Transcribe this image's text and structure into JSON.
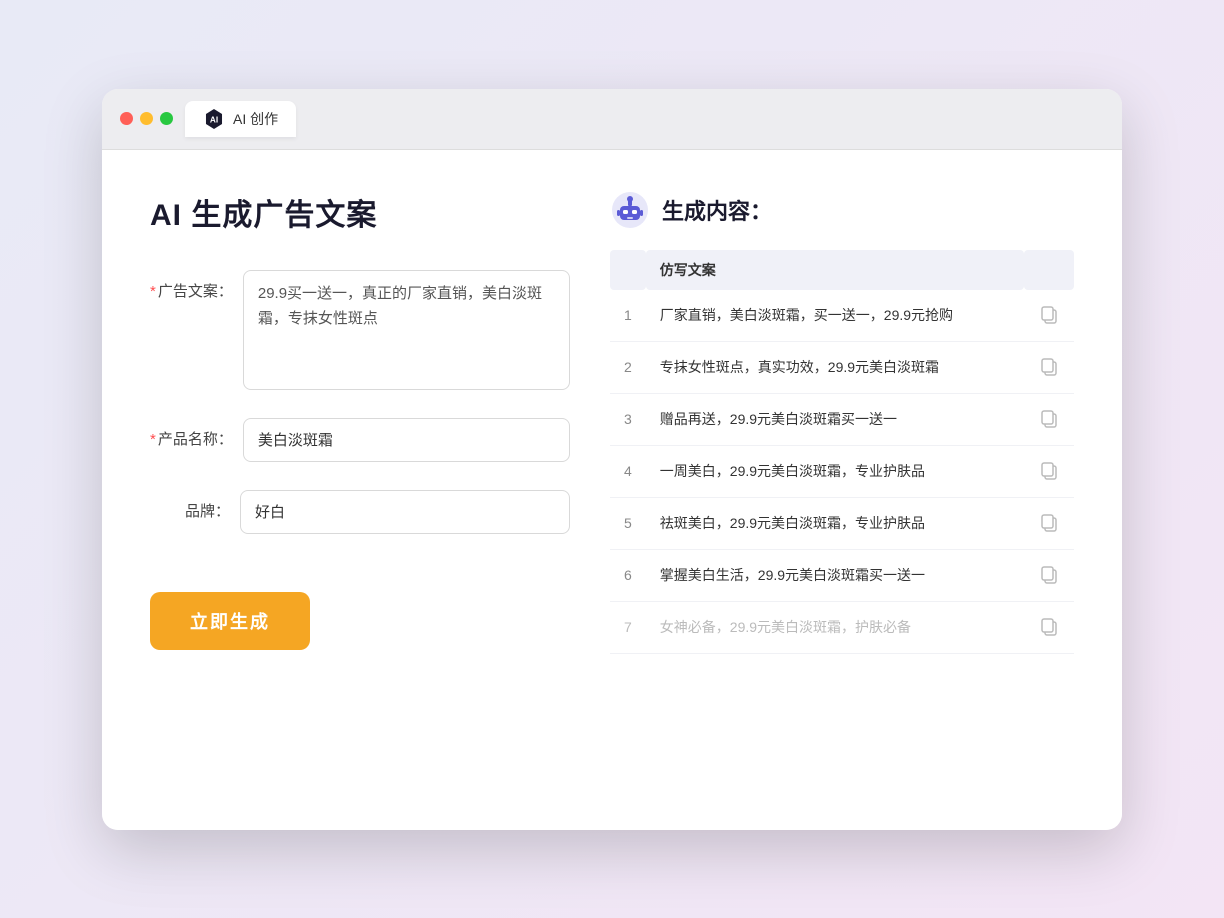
{
  "window": {
    "tab_label": "AI 创作"
  },
  "left": {
    "title": "AI 生成广告文案",
    "ad_label": "广告文案：",
    "ad_required": true,
    "ad_value": "29.9买一送一，真正的厂家直销，美白淡斑霜，专抹女性斑点",
    "product_label": "产品名称：",
    "product_required": true,
    "product_value": "美白淡斑霜",
    "brand_label": "品牌：",
    "brand_required": false,
    "brand_value": "好白",
    "generate_label": "立即生成"
  },
  "right": {
    "title": "生成内容：",
    "table_header": "仿写文案",
    "rows": [
      {
        "num": "1",
        "text": "厂家直销，美白淡斑霜，买一送一，29.9元抢购",
        "faded": false
      },
      {
        "num": "2",
        "text": "专抹女性斑点，真实功效，29.9元美白淡斑霜",
        "faded": false
      },
      {
        "num": "3",
        "text": "赠品再送，29.9元美白淡斑霜买一送一",
        "faded": false
      },
      {
        "num": "4",
        "text": "一周美白，29.9元美白淡斑霜，专业护肤品",
        "faded": false
      },
      {
        "num": "5",
        "text": "祛斑美白，29.9元美白淡斑霜，专业护肤品",
        "faded": false
      },
      {
        "num": "6",
        "text": "掌握美白生活，29.9元美白淡斑霜买一送一",
        "faded": false
      },
      {
        "num": "7",
        "text": "女神必备，29.9元美白淡斑霜，护肤必备",
        "faded": true
      }
    ]
  }
}
